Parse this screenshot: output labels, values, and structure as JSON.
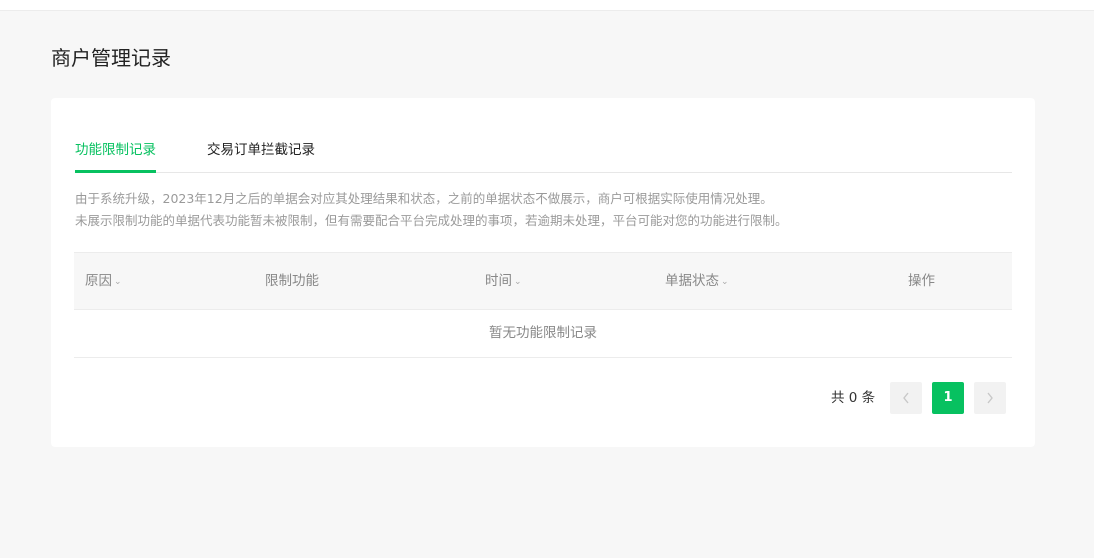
{
  "page": {
    "title": "商户管理记录"
  },
  "tabs": [
    {
      "label": "功能限制记录",
      "active": true
    },
    {
      "label": "交易订单拦截记录",
      "active": false
    }
  ],
  "notice": {
    "line1": "由于系统升级，2023年12月之后的单据会对应其处理结果和状态，之前的单据状态不做展示，商户可根据实际使用情况处理。",
    "line2": "未展示限制功能的单据代表功能暂未被限制，但有需要配合平台完成处理的事项，若逾期未处理，平台可能对您的功能进行限制。"
  },
  "table": {
    "columns": [
      {
        "label": "原因",
        "sortable": true
      },
      {
        "label": "限制功能",
        "sortable": false
      },
      {
        "label": "时间",
        "sortable": true
      },
      {
        "label": "单据状态",
        "sortable": true
      },
      {
        "label": "操作",
        "sortable": false
      }
    ],
    "empty_text": "暂无功能限制记录"
  },
  "pagination": {
    "total_text": "共 0 条",
    "current_page": "1"
  },
  "colors": {
    "accent": "#07c160",
    "background": "#f7f7f7",
    "muted_text": "#9a9a9a"
  },
  "icons": {
    "sort": "chevron-down-icon",
    "prev": "chevron-left-icon",
    "next": "chevron-right-icon"
  }
}
